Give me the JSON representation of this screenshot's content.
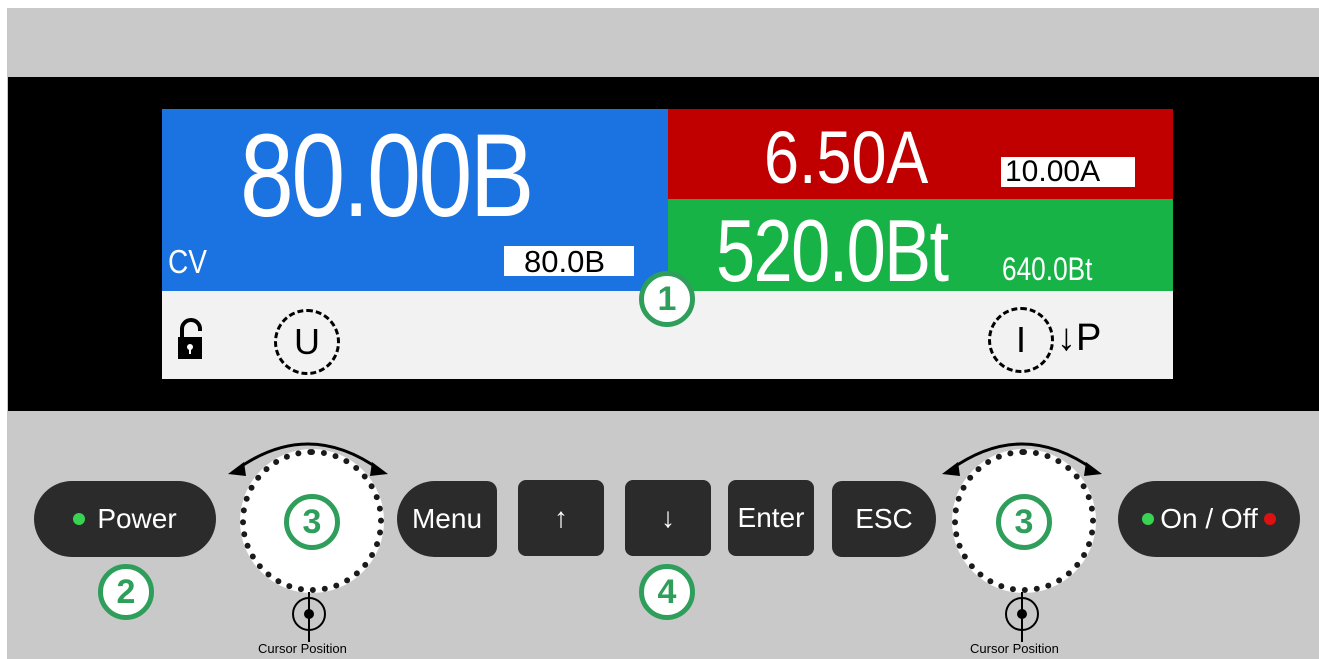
{
  "display": {
    "voltage_actual": "80.00B",
    "mode": "CV",
    "voltage_set": "80.0B",
    "current_actual": "6.50A",
    "current_set": "10.00A",
    "power_actual": "520.0Bt",
    "power_set": "640.0Bt",
    "left_knob_label": "U",
    "right_knob_label": "I",
    "right_knob_sub": "↓P"
  },
  "badges": {
    "display": "1",
    "power": "2",
    "knob": "3",
    "arrows": "4"
  },
  "buttons": {
    "power": "Power",
    "menu": "Menu",
    "up": "↑",
    "down": "↓",
    "enter": "Enter",
    "esc": "ESC",
    "onoff": "On / Off"
  },
  "cursor_label": "Cursor Position",
  "colors": {
    "voltage_bg": "#1a73e0",
    "current_bg": "#c00000",
    "power_bg": "#18b346",
    "badge": "#2f9e5b"
  }
}
